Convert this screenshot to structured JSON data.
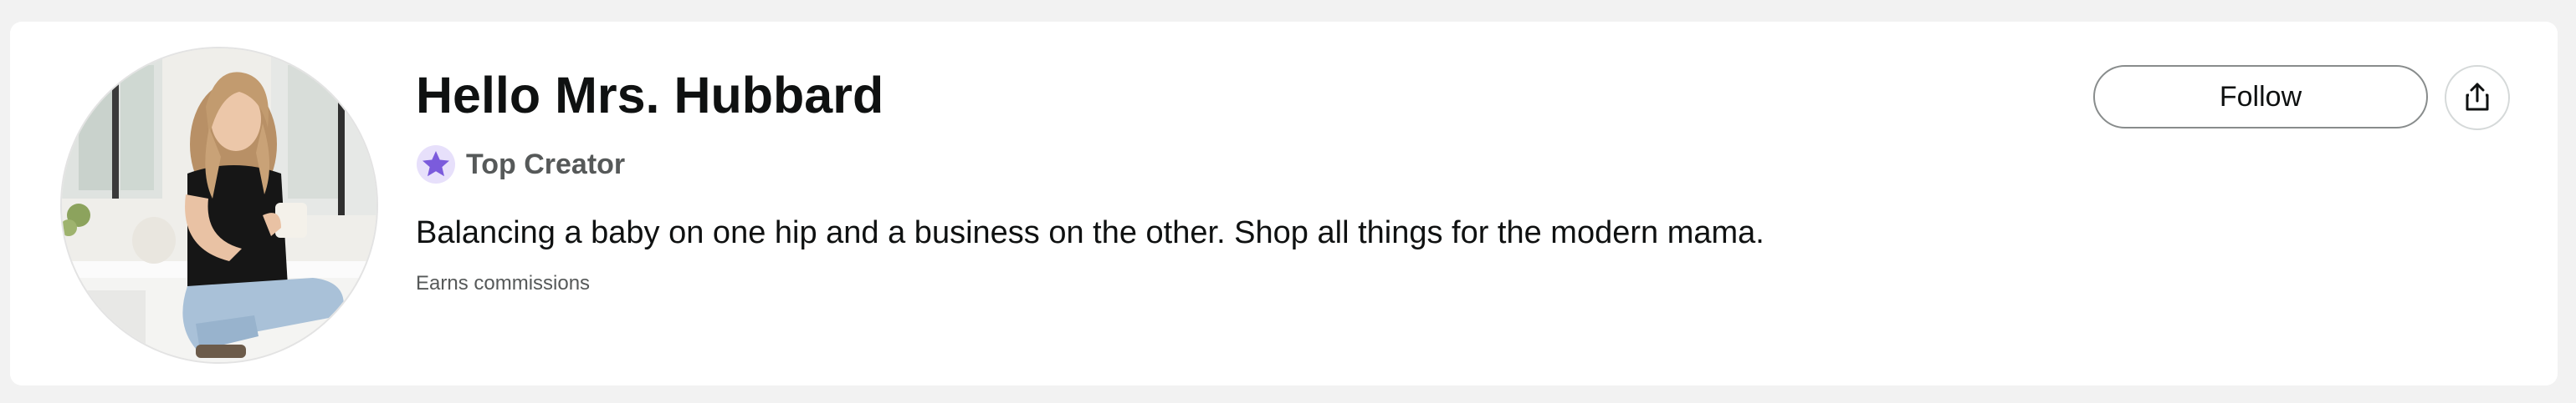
{
  "profile": {
    "name": "Hello Mrs. Hubbard",
    "badge": {
      "label": "Top Creator",
      "icon": "star-icon",
      "color": "#7b5bdc",
      "background": "#e7e0fb"
    },
    "bio": "Balancing a baby on one hip and a business on the other. Shop all things for the modern mama.",
    "disclosure": "Earns commissions",
    "avatar_icon": "avatar-photo"
  },
  "actions": {
    "follow_label": "Follow",
    "share_icon": "share-icon"
  },
  "colors": {
    "page_background": "#f2f2f2",
    "card_background": "#ffffff",
    "text_primary": "#0f1111",
    "text_secondary": "#565959"
  }
}
